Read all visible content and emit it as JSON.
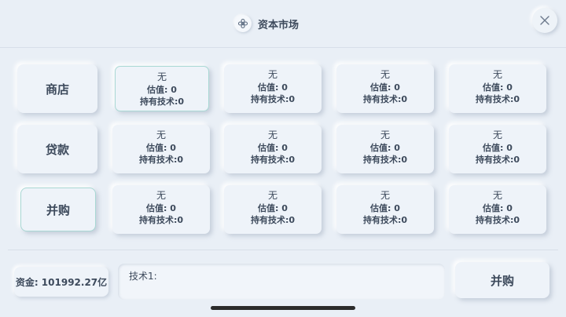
{
  "header": {
    "title": "资本市场"
  },
  "sidebar": {
    "items": [
      {
        "label": "商店"
      },
      {
        "label": "贷款"
      },
      {
        "label": "并购"
      }
    ]
  },
  "grid": {
    "rows": [
      [
        {
          "name": "无",
          "valuation": "估值: 0",
          "tech": "持有技术:0"
        },
        {
          "name": "无",
          "valuation": "估值: 0",
          "tech": "持有技术:0"
        },
        {
          "name": "无",
          "valuation": "估值: 0",
          "tech": "持有技术:0"
        },
        {
          "name": "无",
          "valuation": "估值: 0",
          "tech": "持有技术:0"
        }
      ],
      [
        {
          "name": "无",
          "valuation": "估值: 0",
          "tech": "持有技术:0"
        },
        {
          "name": "无",
          "valuation": "估值: 0",
          "tech": "持有技术:0"
        },
        {
          "name": "无",
          "valuation": "估值: 0",
          "tech": "持有技术:0"
        },
        {
          "name": "无",
          "valuation": "估值: 0",
          "tech": "持有技术:0"
        }
      ],
      [
        {
          "name": "无",
          "valuation": "估值: 0",
          "tech": "持有技术:0"
        },
        {
          "name": "无",
          "valuation": "估值: 0",
          "tech": "持有技术:0"
        },
        {
          "name": "无",
          "valuation": "估值: 0",
          "tech": "持有技术:0"
        },
        {
          "name": "无",
          "valuation": "估值: 0",
          "tech": "持有技术:0"
        }
      ]
    ]
  },
  "footer": {
    "funds": "资金: 101992.27亿",
    "tech_label": "技术1:",
    "merge_button": "并购"
  },
  "icons": {
    "title": "flower-icon",
    "close": "close-icon"
  },
  "colors": {
    "background": "#e9eff6",
    "text": "#3d4a5c",
    "selected_border": "#a9d8d4"
  }
}
